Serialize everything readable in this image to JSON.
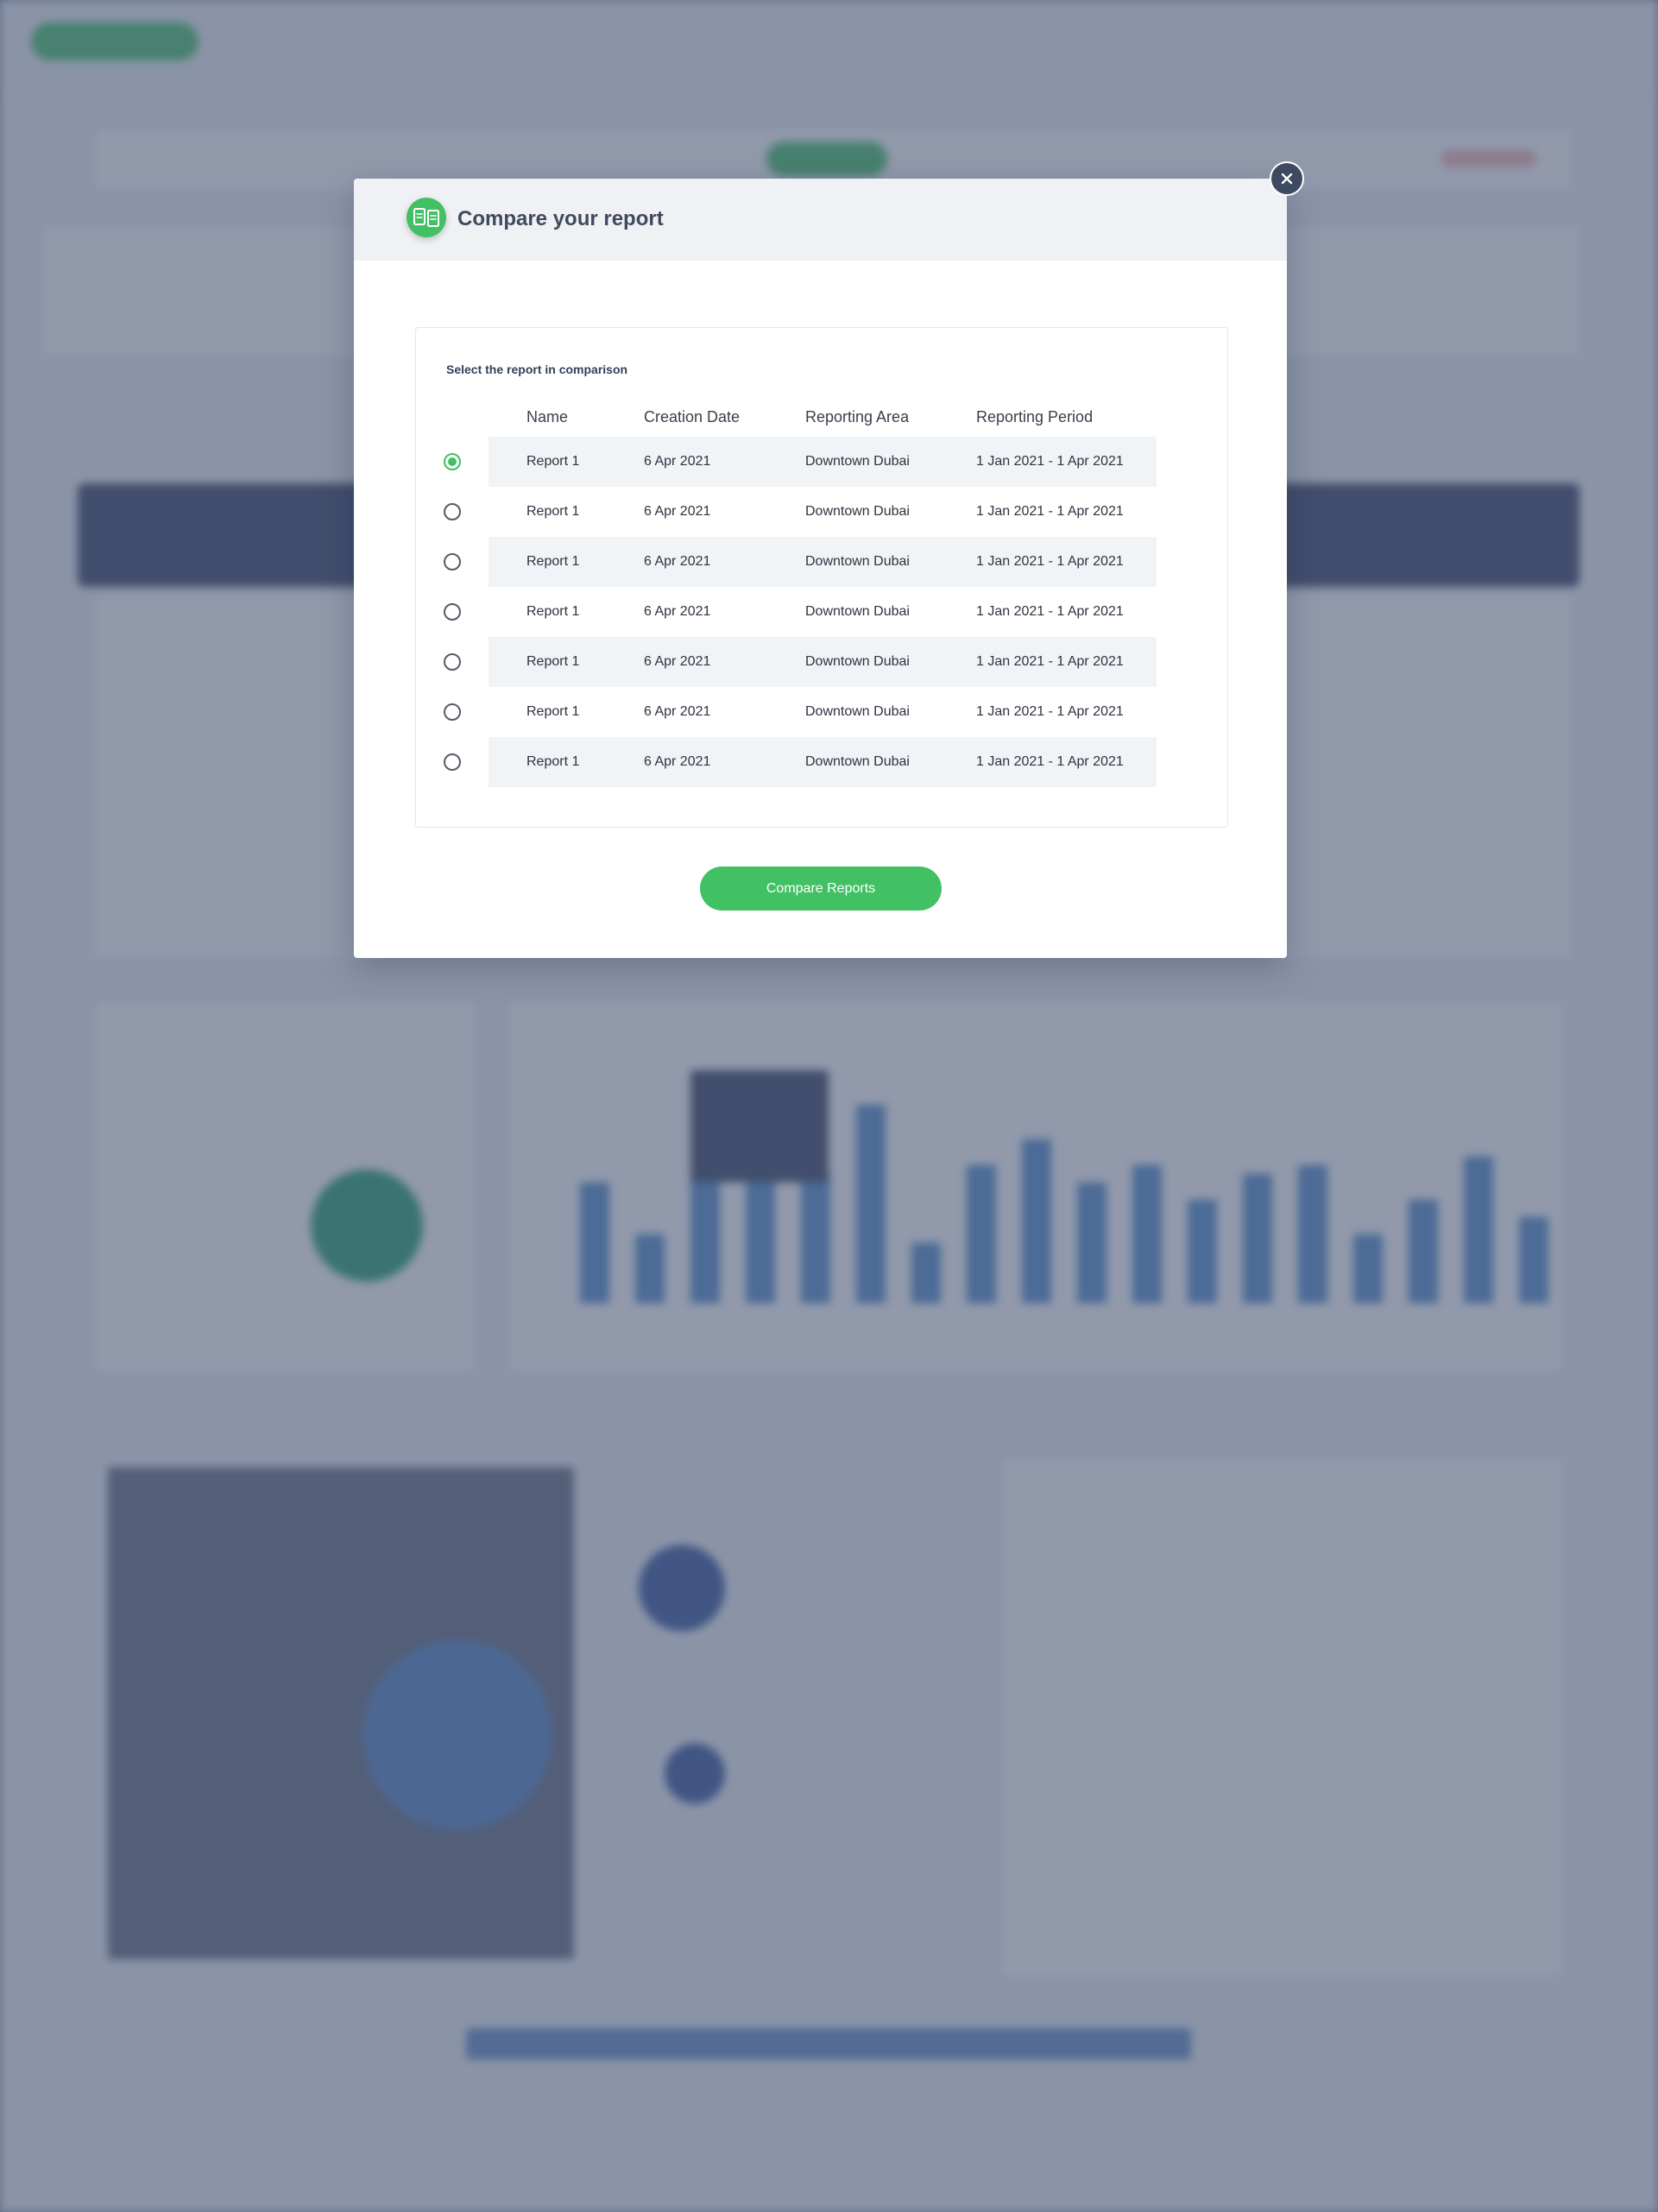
{
  "modal": {
    "title": "Compare your report",
    "close_label": "×",
    "table_caption": "Select the report in comparison",
    "columns": [
      "Name",
      "Creation Date",
      "Reporting Area",
      "Reporting Period"
    ],
    "rows": [
      {
        "selected": true,
        "cells": [
          "Report 1",
          "6 Apr 2021",
          "Downtown Dubai",
          "1 Jan 2021 - 1 Apr 2021"
        ]
      },
      {
        "selected": false,
        "cells": [
          "Report 1",
          "6 Apr 2021",
          "Downtown Dubai",
          "1 Jan 2021 - 1 Apr 2021"
        ]
      },
      {
        "selected": false,
        "cells": [
          "Report 1",
          "6 Apr 2021",
          "Downtown Dubai",
          "1 Jan 2021 - 1 Apr 2021"
        ]
      },
      {
        "selected": false,
        "cells": [
          "Report 1",
          "6 Apr 2021",
          "Downtown Dubai",
          "1 Jan 2021 - 1 Apr 2021"
        ]
      },
      {
        "selected": false,
        "cells": [
          "Report 1",
          "6 Apr 2021",
          "Downtown Dubai",
          "1 Jan 2021 - 1 Apr 2021"
        ]
      },
      {
        "selected": false,
        "cells": [
          "Report 1",
          "6 Apr 2021",
          "Downtown Dubai",
          "1 Jan 2021 - 1 Apr 2021"
        ]
      },
      {
        "selected": false,
        "cells": [
          "Report 1",
          "6 Apr 2021",
          "Downtown Dubai",
          "1 Jan 2021 - 1 Apr 2021"
        ]
      }
    ],
    "compare_button_label": "Compare Reports"
  },
  "colors": {
    "accent": "#41c163",
    "header_bg": "#eff1f5",
    "close_bg": "#3e4a62",
    "row_stripe": "#f1f4f7"
  },
  "icons": {
    "header": "compare-report-icon",
    "close": "close-icon",
    "radio": "radio-icon"
  }
}
